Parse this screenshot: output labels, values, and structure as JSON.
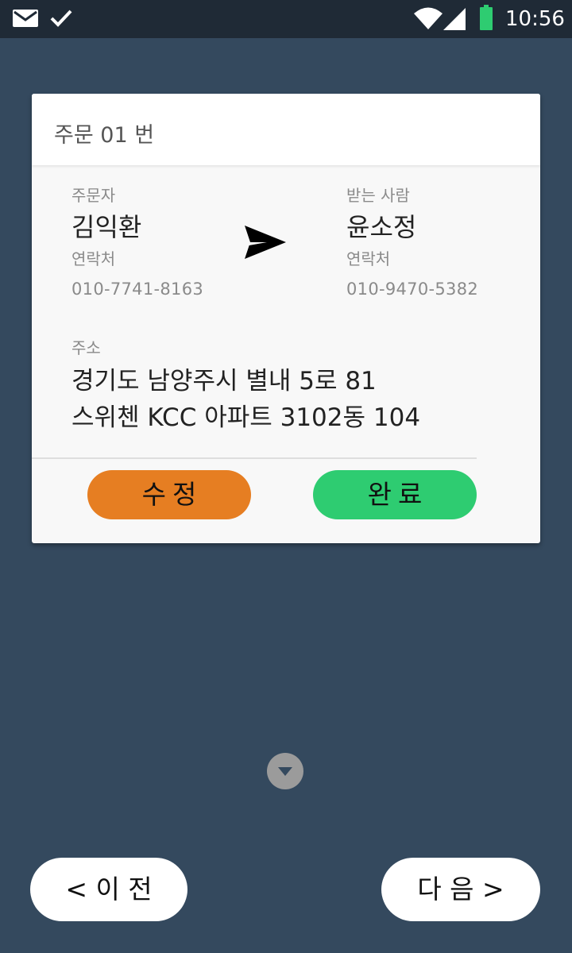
{
  "status_bar": {
    "time": "10:56",
    "icons": [
      "mail-icon",
      "check-icon",
      "wifi-icon",
      "signal-icon",
      "battery-icon"
    ],
    "battery_color": "#2ecc71"
  },
  "order": {
    "title": "주문 01 번",
    "sender": {
      "label": "주문자",
      "name": "김익환",
      "contact_label": "연락처",
      "phone": "010-7741-8163"
    },
    "receiver": {
      "label": "받는 사람",
      "name": "윤소정",
      "contact_label": "연락처",
      "phone": "010-9470-5382"
    },
    "address": {
      "label": "주소",
      "line1": "경기도 남양주시 별내 5로 81",
      "line2": "스위첸 KCC 아파트 3102동 104"
    },
    "actions": {
      "edit_label": "수정",
      "done_label": "완료"
    }
  },
  "navigation": {
    "prev_label": "< 이 전",
    "next_label": "다 음 >"
  },
  "colors": {
    "background": "#34495e",
    "edit": "#e67e22",
    "done": "#2ecc71"
  }
}
